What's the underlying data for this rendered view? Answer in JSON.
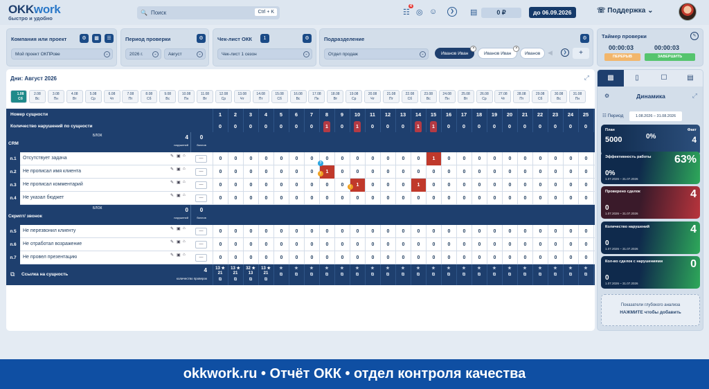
{
  "logo": {
    "brand_a": "OKK",
    "brand_b": "work",
    "tagline": "быстро и удобно"
  },
  "search": {
    "placeholder": "Поиск",
    "shortcut": "Ctrl + K"
  },
  "header": {
    "notif_count": "4",
    "balance": "0 ₽",
    "paid_until": "до 06.09.2026",
    "support": "Поддержка"
  },
  "filters": {
    "company_label": "Компания или проект",
    "company_value": "Мой проект ОКПРове",
    "period_label": "Период проверки",
    "period_year": "2026 г.",
    "period_month": "Август",
    "checklist_label": "Чек-лист ОКК",
    "checklist_count": "1",
    "checklist_value": "Чек-лист 1 сезон",
    "division_label": "Подразделение",
    "division_value": "Отдел продаж",
    "employees": [
      "Иванов Иван",
      "Иванов Иван",
      "Иванов"
    ]
  },
  "timer": {
    "title": "Таймер проверки",
    "t1": "00:00:03",
    "t2": "00:00:03",
    "pause": "ПЕРЕРЫВ",
    "finish": "ЗАВЕРШИТЬ"
  },
  "days_title": "Дни: Август 2026",
  "days": [
    [
      "1.08",
      "Сб"
    ],
    [
      "2.08",
      "Вс"
    ],
    [
      "3.08",
      "Пн"
    ],
    [
      "4.08",
      "Вт"
    ],
    [
      "5.08",
      "Ср"
    ],
    [
      "6.08",
      "Чт"
    ],
    [
      "7.08",
      "Пт"
    ],
    [
      "8.08",
      "Сб"
    ],
    [
      "9.08",
      "Вс"
    ],
    [
      "10.08",
      "Пн"
    ],
    [
      "11.08",
      "Вт"
    ],
    [
      "12.08",
      "Ср"
    ],
    [
      "13.08",
      "Чт"
    ],
    [
      "14.08",
      "Пт"
    ],
    [
      "15.08",
      "Сб"
    ],
    [
      "16.08",
      "Вс"
    ],
    [
      "17.08",
      "Пн"
    ],
    [
      "18.08",
      "Вт"
    ],
    [
      "19.08",
      "Ср"
    ],
    [
      "20.08",
      "Чт"
    ],
    [
      "21.08",
      "Пт"
    ],
    [
      "22.08",
      "Сб"
    ],
    [
      "23.08",
      "Вс"
    ],
    [
      "24.08",
      "Пн"
    ],
    [
      "25.08",
      "Вт"
    ],
    [
      "26.08",
      "Ср"
    ],
    [
      "27.08",
      "Чт"
    ],
    [
      "28.08",
      "Пт"
    ],
    [
      "29.08",
      "Сб"
    ],
    [
      "30.08",
      "Вс"
    ],
    [
      "31.08",
      "Пн"
    ]
  ],
  "table": {
    "entity_header": "Номер сущности",
    "violations_header": "Количество нарушений по сущности",
    "block_label": "БЛОК",
    "violations_word": "нарушений",
    "points_word": "баллов",
    "entity_cols": [
      "1",
      "2",
      "3",
      "4",
      "5",
      "6",
      "7",
      "8",
      "9",
      "10",
      "11",
      "12",
      "13",
      "14",
      "15",
      "16",
      "17",
      "18",
      "19",
      "20",
      "21",
      "22",
      "23",
      "24",
      "25"
    ],
    "violations_row": [
      "0",
      "0",
      "0",
      "0",
      "0",
      "0",
      "0",
      "1",
      "0",
      "1",
      "0",
      "0",
      "0",
      "1",
      "1",
      "0",
      "0",
      "0",
      "0",
      "0",
      "0",
      "0",
      "0",
      "0",
      "0"
    ],
    "blocks": [
      {
        "name": "CRM",
        "violations": "4",
        "points": "0",
        "items": [
          {
            "id": "п.1",
            "name": "Отсутствует задача",
            "vals": [
              "0",
              "0",
              "0",
              "0",
              "0",
              "0",
              "0",
              "0",
              "0",
              "0",
              "0",
              "0",
              "0",
              "0",
              "1",
              "0",
              "0",
              "0",
              "0",
              "0",
              "0",
              "0",
              "0",
              "0",
              "0"
            ]
          },
          {
            "id": "п.2",
            "name": "Не прописал имя клиента",
            "vals": [
              "0",
              "0",
              "0",
              "0",
              "0",
              "0",
              "0",
              "1",
              "0",
              "0",
              "0",
              "0",
              "0",
              "0",
              "0",
              "0",
              "0",
              "0",
              "0",
              "0",
              "0",
              "0",
              "0",
              "0",
              "0"
            ]
          },
          {
            "id": "п.3",
            "name": "Не прописал комментарий",
            "vals": [
              "0",
              "0",
              "0",
              "0",
              "0",
              "0",
              "0",
              "0",
              "0",
              "1",
              "0",
              "0",
              "0",
              "1",
              "0",
              "0",
              "0",
              "0",
              "0",
              "0",
              "0",
              "0",
              "0",
              "0",
              "0"
            ]
          },
          {
            "id": "п.4",
            "name": "Не указал бюджет",
            "vals": [
              "0",
              "0",
              "0",
              "0",
              "0",
              "0",
              "0",
              "0",
              "0",
              "0",
              "0",
              "0",
              "0",
              "0",
              "0",
              "0",
              "0",
              "0",
              "0",
              "0",
              "0",
              "0",
              "0",
              "0",
              "0"
            ]
          }
        ]
      },
      {
        "name": "Скрипт/ звонок",
        "violations": "0",
        "points": "0",
        "items": [
          {
            "id": "п.5",
            "name": "Не перезвонил клиенту",
            "vals": [
              "0",
              "0",
              "0",
              "0",
              "0",
              "0",
              "0",
              "0",
              "0",
              "0",
              "0",
              "0",
              "0",
              "0",
              "0",
              "0",
              "0",
              "0",
              "0",
              "0",
              "0",
              "0",
              "0",
              "0",
              "0"
            ]
          },
          {
            "id": "п.6",
            "name": "Не отработал возражение",
            "vals": [
              "0",
              "0",
              "0",
              "0",
              "0",
              "0",
              "0",
              "0",
              "0",
              "0",
              "0",
              "0",
              "0",
              "0",
              "0",
              "0",
              "0",
              "0",
              "0",
              "0",
              "0",
              "0",
              "0",
              "0",
              "0"
            ]
          },
          {
            "id": "п.7",
            "name": "Не провел презентацию",
            "vals": [
              "0",
              "0",
              "0",
              "0",
              "0",
              "0",
              "0",
              "0",
              "0",
              "0",
              "0",
              "0",
              "0",
              "0",
              "0",
              "0",
              "0",
              "0",
              "0",
              "0",
              "0",
              "0",
              "0",
              "0",
              "0"
            ]
          }
        ]
      }
    ],
    "link_label": "Ссылка на сущность",
    "link_count": "4",
    "link_count_label": "количество проверок",
    "link_vals": [
      "13 ★ 21",
      "13 ★ 21",
      "32 ★ 13",
      "13 ★ 21"
    ]
  },
  "panel": {
    "title": "Динамика",
    "period_label": "Период",
    "period_value": "1.08.2026 – 31.08.2026",
    "plan_label": "План",
    "plan_value": "5000",
    "plan_pct": "0%",
    "fact_label": "Факт",
    "fact_value": "4",
    "m1_label": "Эффективность работы",
    "m1_value": "63%",
    "m1_sub": "0%",
    "m1_date": "1.07.2026 – 31.07.2026",
    "m2_label": "Проверено сделок",
    "m2_value": "4",
    "m2_sub": "0",
    "m2_date": "1.07.2026 – 31.07.2026",
    "m3_label": "Количество нарушений",
    "m3_value": "4",
    "m3_sub": "0",
    "m3_date": "1.07.2026 – 31.07.2026",
    "m4_label": "Кол-во сделок с нарушениями",
    "m4_value": "0",
    "m4_sub": "0",
    "m4_date": "1.07.2026 – 31.07.2026",
    "deep_label": "Показатели глубокого анализа",
    "deep_action": "НАЖМИТЕ чтобы добавить"
  },
  "footer": "okkwork.ru  •  Отчёт ОКК  •  отдел контроля качества",
  "colors": {
    "navy": "#1e3f6e",
    "accent": "#2a78c8",
    "violation": "#c0392b",
    "footer": "#0f4fa3"
  }
}
